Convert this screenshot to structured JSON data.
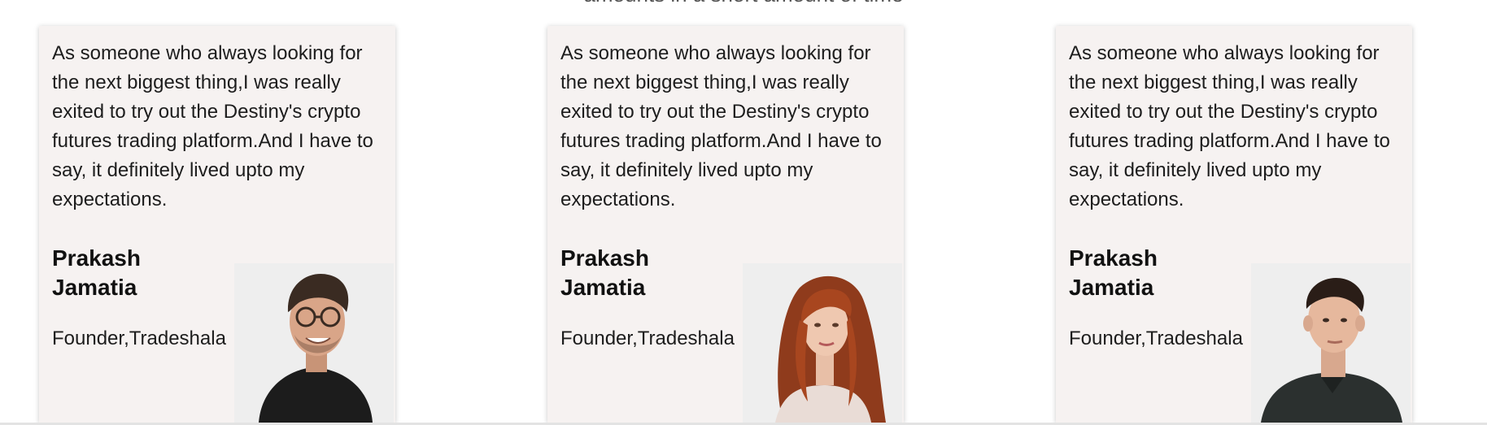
{
  "section": {
    "subtitle": "amounts in a short amount of time"
  },
  "testimonials": [
    {
      "quote": "As someone who always looking for the next biggest thing,I was really exited to try out the Destiny's crypto futures trading platform.And I have to say, it definitely lived upto my expectations.",
      "name": "Prakash Jamatia",
      "role": "Founder,Tradeshala",
      "photo_icon": "man-with-glasses-avatar"
    },
    {
      "quote": "As someone who always looking for the next biggest thing,I was really exited to try out the Destiny's crypto futures trading platform.And I have to say, it definitely lived upto my expectations.",
      "name": "Prakash Jamatia",
      "role": "Founder,Tradeshala",
      "photo_icon": "red-haired-woman-avatar"
    },
    {
      "quote": "As someone who always looking for the next biggest thing,I was really exited to try out the Destiny's crypto futures trading platform.And I have to say, it definitely lived upto my expectations.",
      "name": "Prakash Jamatia",
      "role": "Founder,Tradeshala",
      "photo_icon": "young-man-avatar"
    }
  ],
  "colors": {
    "card_background": "#f6f2f1",
    "text": "#1d1d1d",
    "photo_background": "#eeeeee"
  }
}
